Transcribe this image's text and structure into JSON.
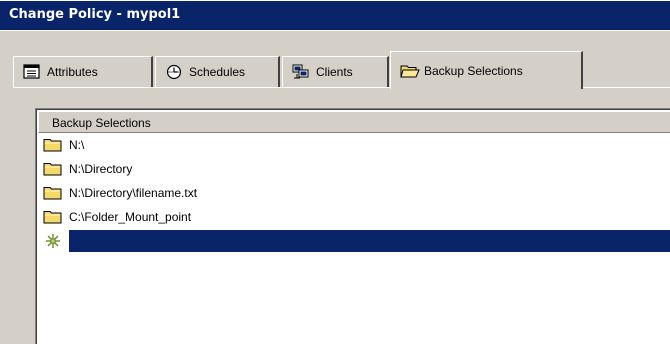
{
  "window": {
    "title": "Change Policy - mypol1"
  },
  "tabs": [
    {
      "label": "Attributes",
      "icon": "attributes-icon",
      "active": false
    },
    {
      "label": "Schedules",
      "icon": "schedules-icon",
      "active": false
    },
    {
      "label": "Clients",
      "icon": "clients-icon",
      "active": false
    },
    {
      "label": "Backup Selections",
      "icon": "folder-open-icon",
      "active": true
    }
  ],
  "list": {
    "header": "Backup Selections",
    "items": [
      {
        "label": "N:\\",
        "icon": "folder-icon"
      },
      {
        "label": "N:\\Directory",
        "icon": "folder-icon"
      },
      {
        "label": "N:\\Directory\\filename.txt",
        "icon": "folder-icon"
      },
      {
        "label": "C:\\Folder_Mount_point",
        "icon": "folder-icon"
      }
    ],
    "new_entry": {
      "value": "",
      "icon": "new-item-sparkle-icon"
    }
  },
  "colors": {
    "titlebar": "#0a246a",
    "selection": "#0a246a",
    "face": "#d4d0c8",
    "folder": "#f5d96b"
  }
}
